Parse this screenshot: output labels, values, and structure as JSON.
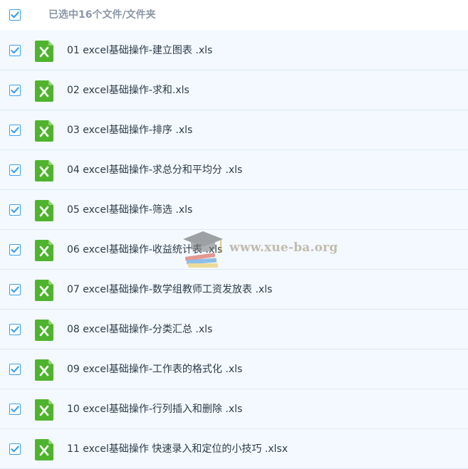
{
  "header": {
    "selected_label": "已选中16个文件/文件夹",
    "checked": true
  },
  "files": [
    {
      "name": "01 excel基础操作-建立图表 .xls",
      "checked": true,
      "icon": "excel-file-icon"
    },
    {
      "name": "02 excel基础操作-求和.xls",
      "checked": true,
      "icon": "excel-file-icon"
    },
    {
      "name": "03 excel基础操作-排序 .xls",
      "checked": true,
      "icon": "excel-file-icon"
    },
    {
      "name": "04 excel基础操作-求总分和平均分 .xls",
      "checked": true,
      "icon": "excel-file-icon"
    },
    {
      "name": "05 excel基础操作-筛选 .xls",
      "checked": true,
      "icon": "excel-file-icon"
    },
    {
      "name": "06 excel基础操作-收益统计表 .xls",
      "checked": true,
      "icon": "excel-file-icon"
    },
    {
      "name": "07 excel基础操作-数学组教师工资发放表 .xls",
      "checked": true,
      "icon": "excel-file-icon"
    },
    {
      "name": "08 excel基础操作-分类汇总 .xls",
      "checked": true,
      "icon": "excel-file-icon"
    },
    {
      "name": "09 excel基础操作-工作表的格式化 .xls",
      "checked": true,
      "icon": "excel-file-icon"
    },
    {
      "name": "10 excel基础操作-行列插入和删除 .xls",
      "checked": true,
      "icon": "excel-file-icon"
    },
    {
      "name": "11 excel基础操作 快速录入和定位的小技巧 .xlsx",
      "checked": true,
      "icon": "excel-file-icon"
    }
  ],
  "watermark": {
    "text": "www.xue-ba.org"
  },
  "colors": {
    "accent": "#3ba1f2",
    "excel_green": "#4fb32e",
    "row_bg": "#f3f9fe"
  }
}
